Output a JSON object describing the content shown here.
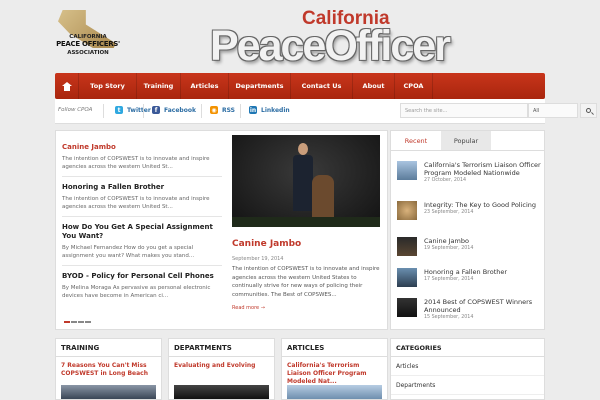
{
  "logo": {
    "line1": "CALIFORNIA",
    "line2": "PEACE OFFICERS'",
    "line3": "ASSOCIATION"
  },
  "masthead": {
    "top": "California",
    "main": "PeaceOfficer"
  },
  "nav": {
    "items": [
      "Top Story",
      "Training",
      "Articles",
      "Departments",
      "Contact Us",
      "About",
      "CPOA"
    ]
  },
  "social": {
    "follow": "Follow CPOA",
    "twitter": "Twitter",
    "facebook": "Facebook",
    "rss": "RSS",
    "linkedin": "Linkedin",
    "search_placeholder": "Search the site...",
    "search_scope": "All"
  },
  "featured_list": [
    {
      "title": "Canine Jambo",
      "desc": "The intention of COPSWEST is to innovate and inspire agencies across the western United St..."
    },
    {
      "title": "Honoring a Fallen Brother",
      "desc": "The intention of COPSWEST is to innovate and inspire agencies across the western United St..."
    },
    {
      "title": "How Do You Get A Special Assignment You Want?",
      "desc": "By Michael Fernandez How do you get a special assignment you want? What makes you stand..."
    },
    {
      "title": "BYOD - Policy for Personal Cell Phones",
      "desc": "By Melina Moraga As pervasive as personal electronic devices have become in American ci..."
    }
  ],
  "featured_main": {
    "title": "Canine Jambo",
    "date": "September 19, 2014",
    "excerpt": "The intention of COPSWEST is to innovate and inspire agencies across the western United States to continually strive for new ways of policing their communities. The Best of COPSWES...",
    "more": "Read more →"
  },
  "tabs": {
    "recent": "Recent",
    "popular": "Popular"
  },
  "recent": [
    {
      "title": "California's Terrorism Liaison Officer Program Modeled Nationwide",
      "date": "27 October, 2014"
    },
    {
      "title": "Integrity: The Key to Good Policing",
      "date": "23 September, 2014"
    },
    {
      "title": "Canine Jambo",
      "date": "19 September, 2014"
    },
    {
      "title": "Honoring a Fallen Brother",
      "date": "17 September, 2014"
    },
    {
      "title": "2014 Best of COPSWEST Winners Announced",
      "date": "15 September, 2014"
    }
  ],
  "bottom": {
    "training": {
      "header": "TRAINING",
      "title": "7 Reasons You Can't Miss COPSWEST in Long Beach"
    },
    "departments": {
      "header": "DEPARTMENTS",
      "title": "Evaluating and Evolving"
    },
    "articles": {
      "header": "ARTICLES",
      "title": "California's Terrorism Liaison Officer Program Modeled Nat..."
    },
    "categories": {
      "header": "CATEGORIES",
      "items": [
        "Articles",
        "Departments"
      ]
    }
  },
  "colors": {
    "accent": "#c0392b",
    "nav": "#b52d14"
  }
}
